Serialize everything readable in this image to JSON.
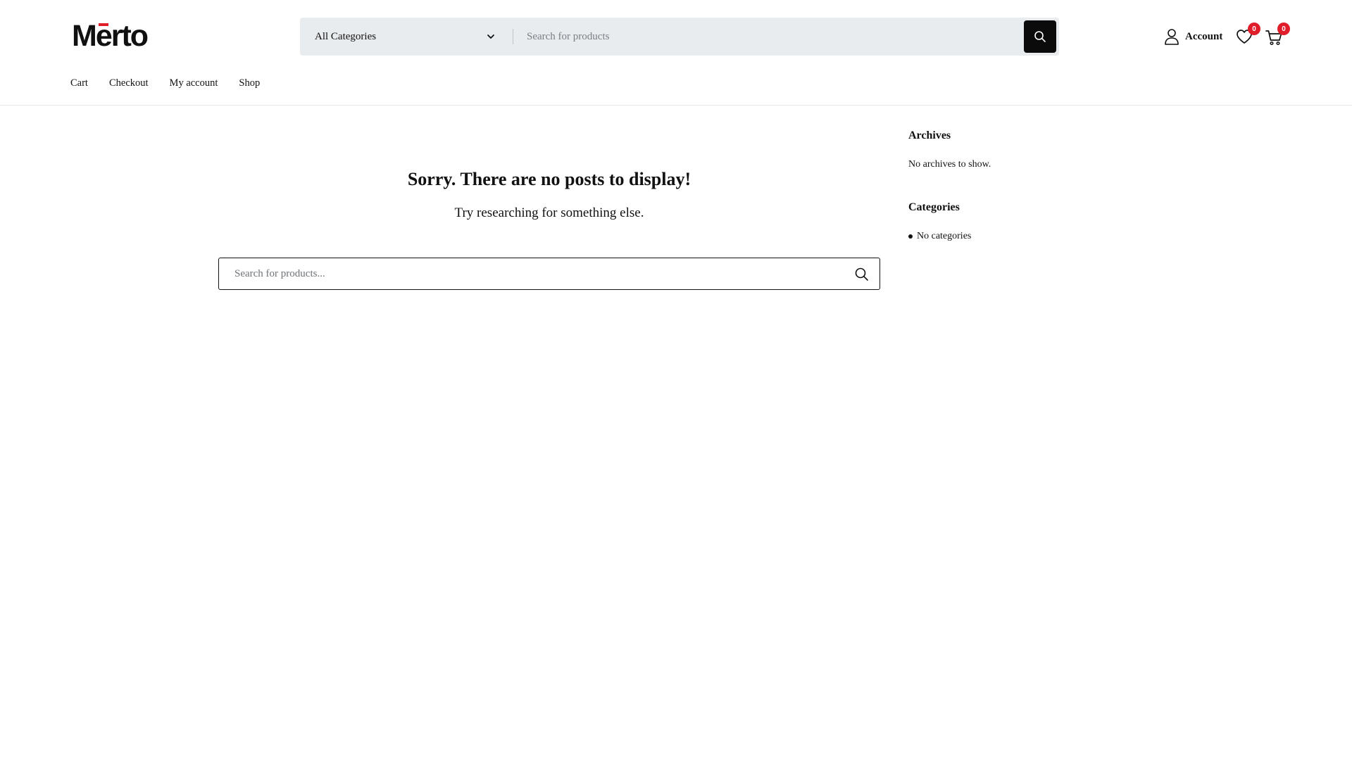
{
  "header": {
    "logo_text_before": "M",
    "logo_accent_letter": "ē",
    "logo_text_after": "rto",
    "logo_accent_color": "#e01e2b",
    "category_select": "All Categories",
    "search_placeholder": "Search for products",
    "account_label": "Account",
    "wishlist_count": "0",
    "cart_count": "0",
    "badge_color": "#e01e2b"
  },
  "nav": {
    "items": [
      "Cart",
      "Checkout",
      "My account",
      "Shop"
    ]
  },
  "main": {
    "title": "Sorry. There are no posts to display!",
    "subtitle": "Try researching for something else.",
    "search_placeholder": "Search for products..."
  },
  "sidebar": {
    "archives_title": "Archives",
    "archives_text": "No archives to show.",
    "categories_title": "Categories",
    "categories_items": [
      "No categories"
    ]
  },
  "icons": [
    "chevron-down-icon",
    "search-icon",
    "user-icon",
    "heart-icon",
    "cart-icon"
  ]
}
